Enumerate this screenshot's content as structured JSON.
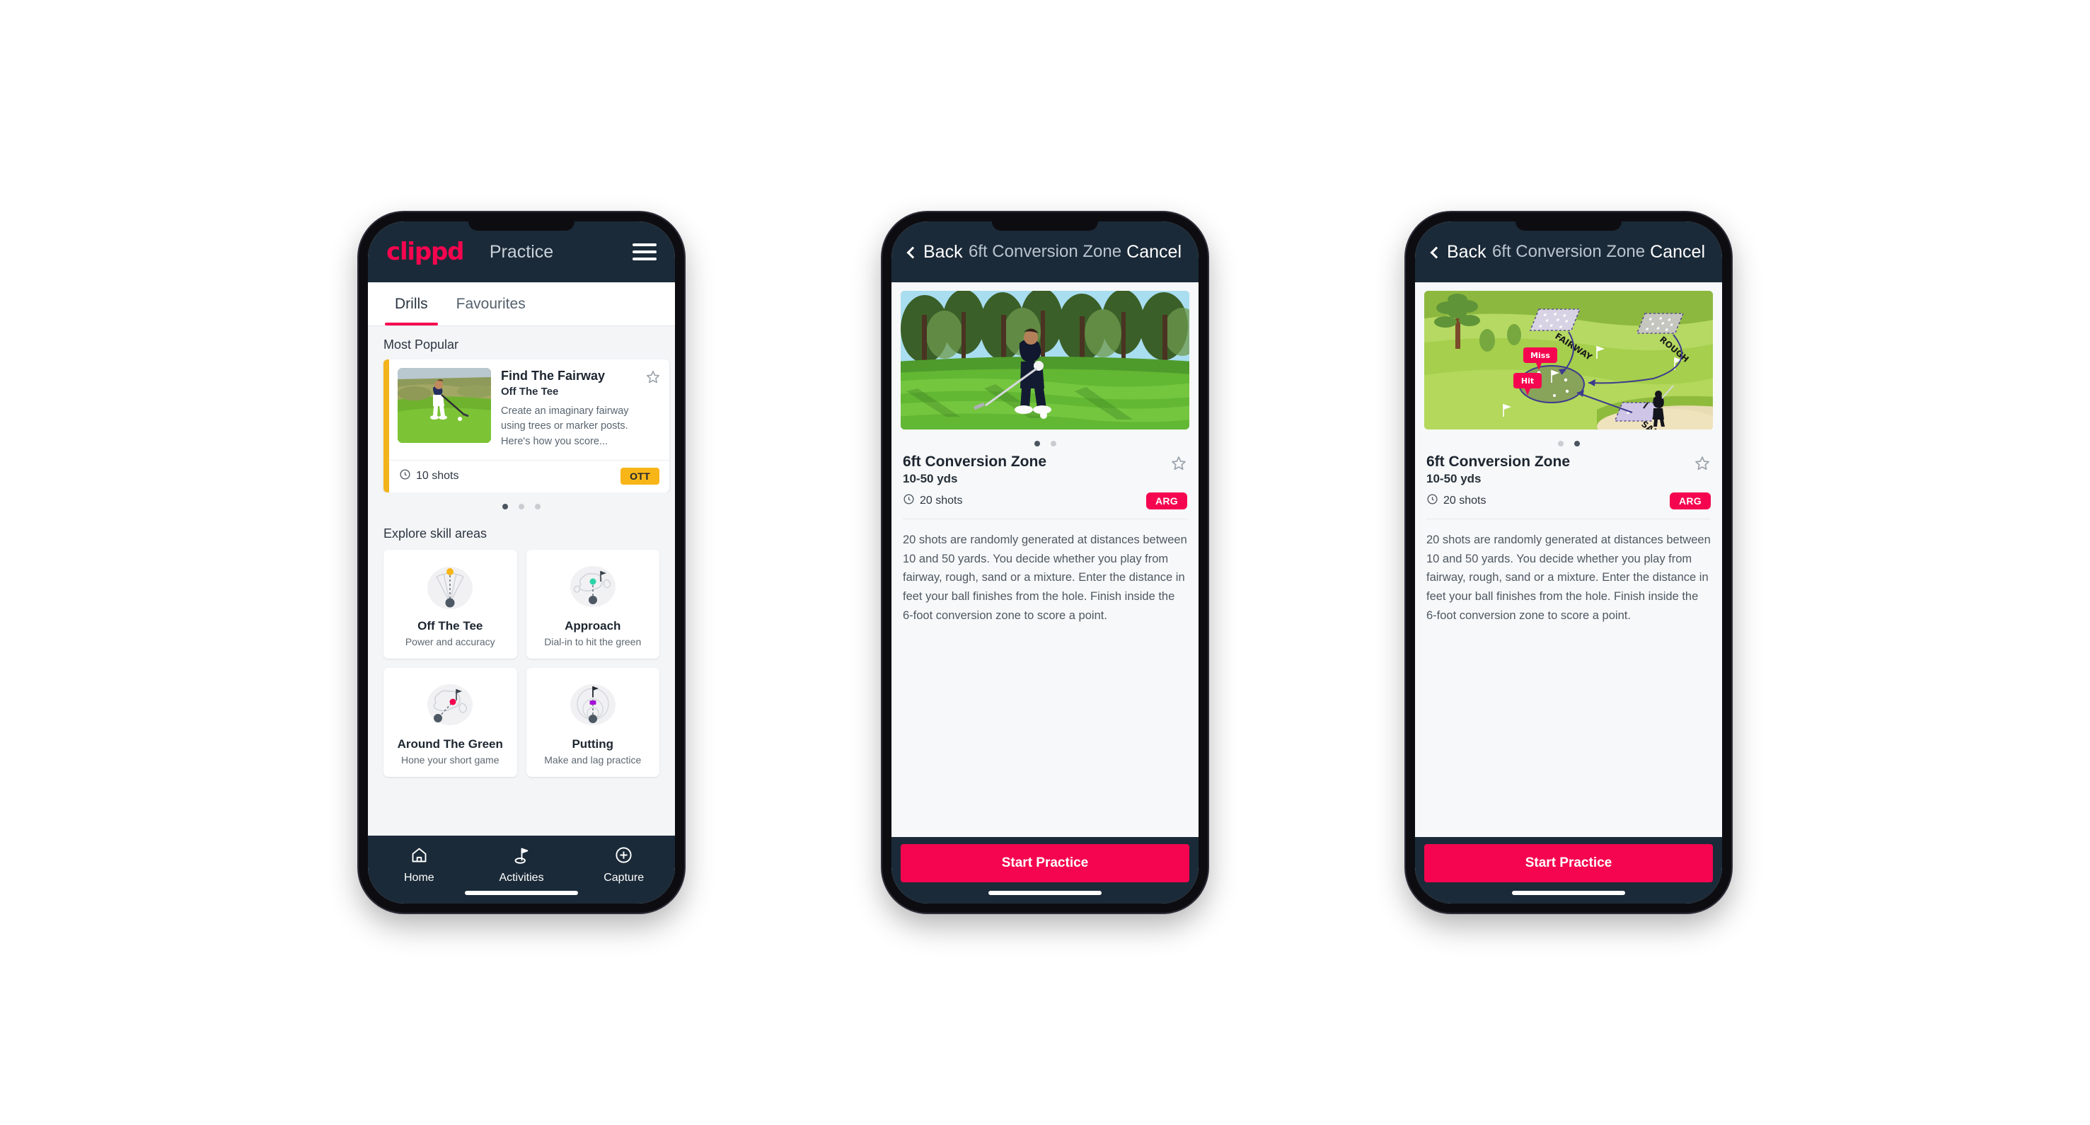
{
  "page": {
    "background": "#ffffff",
    "accent_pink": "#f5054f",
    "dark_navy": "#1b2a38",
    "amber": "#f7b518",
    "teal": "#3fe0b0"
  },
  "phone1": {
    "appbar": {
      "logo": "clippd",
      "title": "Practice",
      "menu_icon": "hamburger-icon"
    },
    "tabs": [
      {
        "label": "Drills",
        "active": true
      },
      {
        "label": "Favourites",
        "active": false
      }
    ],
    "most_popular": {
      "section_label": "Most Popular",
      "card": {
        "title": "Find The Fairway",
        "subtitle": "Off The Tee",
        "description": "Create an imaginary fairway using trees or marker posts. Here's how you score...",
        "shots": "10 shots",
        "badge": "OTT",
        "accent_color": "#f3b31c",
        "star_icon": "star-outline-icon",
        "clock_icon": "clock-icon"
      },
      "dots": [
        true,
        false,
        false
      ]
    },
    "explore": {
      "section_label": "Explore skill areas",
      "cards": [
        {
          "name": "Off The Tee",
          "desc": "Power and accuracy",
          "dot_color": "#f7b518",
          "icon": "off-the-tee-icon"
        },
        {
          "name": "Approach",
          "desc": "Dial-in to hit the green",
          "dot_color": "#2ad4a8",
          "icon": "approach-icon"
        },
        {
          "name": "Around The Green",
          "desc": "Hone your short game",
          "dot_color": "#f5054f",
          "icon": "around-the-green-icon"
        },
        {
          "name": "Putting",
          "desc": "Make and lag practice",
          "dot_color": "#a511d8",
          "icon": "putting-icon"
        }
      ]
    },
    "bottom_nav": [
      {
        "label": "Home",
        "icon": "home-icon",
        "active": false
      },
      {
        "label": "Activities",
        "icon": "golf-flag-icon",
        "active": true
      },
      {
        "label": "Capture",
        "icon": "plus-circle-icon",
        "active": false
      }
    ]
  },
  "phone2": {
    "navbar": {
      "back": "Back",
      "title": "6ft Conversion Zone",
      "cancel": "Cancel",
      "back_icon": "chevron-left-icon"
    },
    "media": {
      "type": "video-thumbnail",
      "alt": "golfer-chipping-photo"
    },
    "dots": [
      true,
      false
    ],
    "detail": {
      "title": "6ft Conversion Zone",
      "subtitle": "10-50 yds",
      "shots": "20 shots",
      "badge": "ARG",
      "star_icon": "star-outline-icon",
      "clock_icon": "clock-icon",
      "description": "20 shots are randomly generated at distances between 10 and 50 yards. You decide whether you play from fairway, rough, sand or a mixture. Enter the distance in feet your ball finishes from the hole. Finish inside the 6-foot conversion zone to score a point."
    },
    "cta": "Start Practice"
  },
  "phone3": {
    "navbar": {
      "back": "Back",
      "title": "6ft Conversion Zone",
      "cancel": "Cancel",
      "back_icon": "chevron-left-icon"
    },
    "media": {
      "type": "course-diagram",
      "labels": {
        "fairway": "FAIRWAY",
        "rough": "ROUGH",
        "sand": "SAND",
        "miss": "Miss",
        "hit": "Hit"
      }
    },
    "dots": [
      false,
      true
    ],
    "detail": {
      "title": "6ft Conversion Zone",
      "subtitle": "10-50 yds",
      "shots": "20 shots",
      "badge": "ARG",
      "star_icon": "star-outline-icon",
      "clock_icon": "clock-icon",
      "description": "20 shots are randomly generated at distances between 10 and 50 yards. You decide whether you play from fairway, rough, sand or a mixture. Enter the distance in feet your ball finishes from the hole. Finish inside the 6-foot conversion zone to score a point."
    },
    "cta": "Start Practice"
  }
}
